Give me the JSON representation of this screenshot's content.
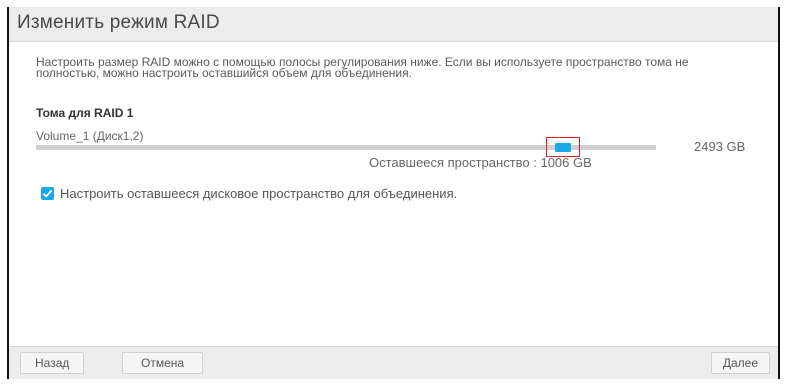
{
  "dialog": {
    "title": "Изменить режим RAID",
    "description": "Настроить размер RAID можно с помощью полосы регулирования ниже. Если вы используете пространство тома не полностью, можно настроить оставшийся объем для объединения.",
    "section_title": "Тома для RAID 1",
    "volume": {
      "label": "Volume_1 (Диск1,2)",
      "total": "2493 GB",
      "remaining": "Оставшееся пространство : 1006 GB",
      "slider_fraction": 0.85
    },
    "checkbox": {
      "checked": true,
      "label": "Настроить оставшееся дисковое пространство для объединения."
    }
  },
  "footer": {
    "back_label": "Назад",
    "cancel_label": "Отмена",
    "next_label": "Далее"
  },
  "colors": {
    "accent": "#1aa7e8",
    "highlight": "#e02020"
  }
}
